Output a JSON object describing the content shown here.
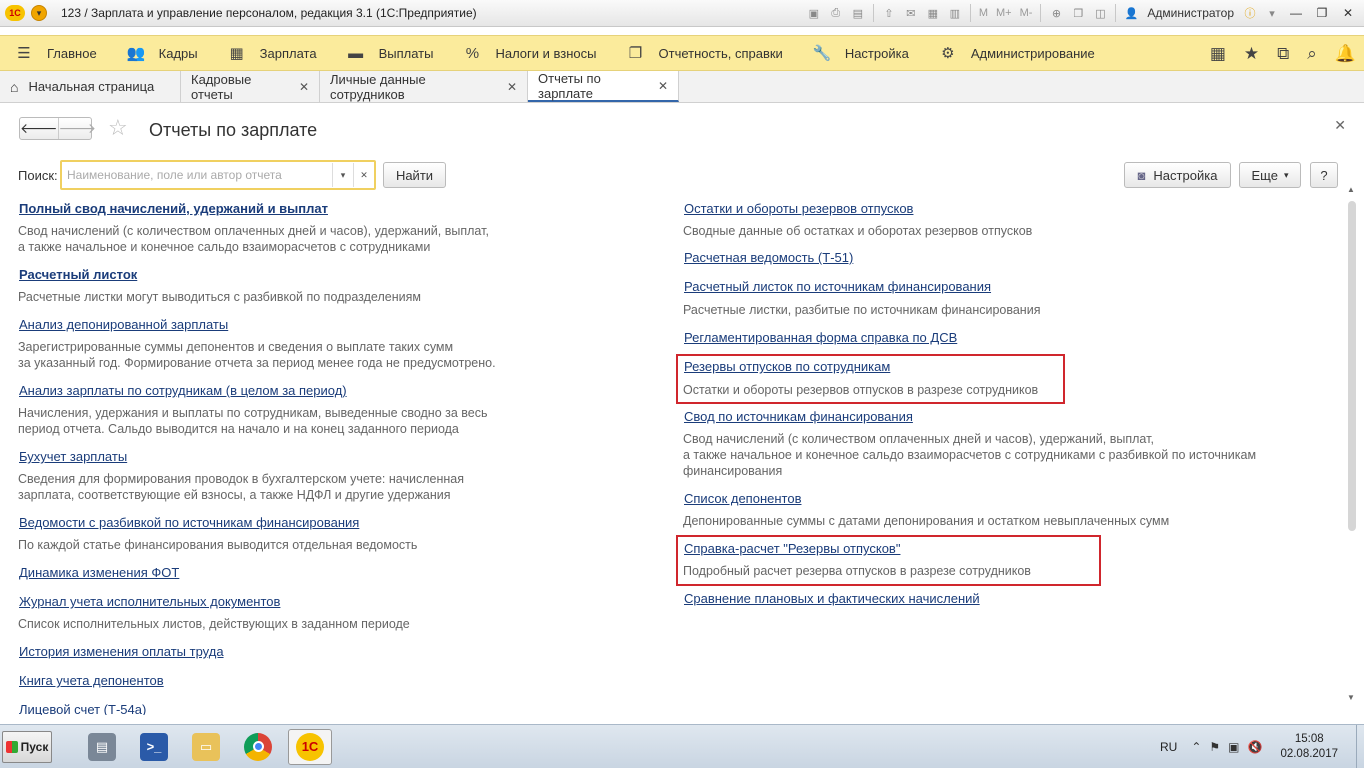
{
  "titlebar": {
    "title": "123 / Зарплата и управление персоналом, редакция 3.1  (1С:Предприятие)",
    "logo_text": "1С",
    "user": "Администратор",
    "m_buttons": [
      "M",
      "M+",
      "M-"
    ]
  },
  "menu": {
    "items": [
      {
        "icon": "hamburger-icon",
        "glyph": "☰",
        "label": "Главное"
      },
      {
        "icon": "people-icon",
        "glyph": "👥",
        "label": "Кадры"
      },
      {
        "icon": "calculator-icon",
        "glyph": "▦",
        "label": "Зарплата"
      },
      {
        "icon": "wallet-icon",
        "glyph": "▬",
        "label": "Выплаты"
      },
      {
        "icon": "percent-icon",
        "glyph": "%",
        "label": "Налоги и взносы"
      },
      {
        "icon": "documents-icon",
        "glyph": "❐",
        "label": "Отчетность, справки"
      },
      {
        "icon": "wrench-icon",
        "glyph": "🔧",
        "label": "Настройка"
      },
      {
        "icon": "gear-icon",
        "glyph": "⚙",
        "label": "Администрирование"
      }
    ]
  },
  "tabs": [
    {
      "label": "Начальная страница",
      "home": true,
      "closable": false
    },
    {
      "label": "Кадровые отчеты",
      "closable": true
    },
    {
      "label": "Личные данные сотрудников",
      "closable": true
    },
    {
      "label": "Отчеты по зарплате",
      "closable": true,
      "active": true
    }
  ],
  "form": {
    "title": "Отчеты по зарплате",
    "search_label": "Поиск:",
    "search_placeholder": "Наименование, поле или автор отчета",
    "find_button": "Найти",
    "settings_button": "Настройка",
    "more_button": "Еще",
    "help_button": "?"
  },
  "reports_left": [
    {
      "title": "Полный свод начислений, удержаний и выплат",
      "bold": true,
      "desc": [
        "Свод начислений (с количеством оплаченных дней и часов), удержаний, выплат,",
        "а также начальное и конечное сальдо взаиморасчетов с сотрудниками"
      ]
    },
    {
      "title": "Расчетный листок",
      "bold": true,
      "desc": [
        "Расчетные листки могут выводиться с разбивкой по подразделениям"
      ]
    },
    {
      "title": "Анализ депонированной зарплаты",
      "desc": [
        "Зарегистрированные суммы депонентов и сведения о выплате таких сумм",
        "за указанный год. Формирование отчета за период менее года не предусмотрено."
      ]
    },
    {
      "title": "Анализ зарплаты по сотрудникам (в целом за период)",
      "desc": [
        "Начисления, удержания и выплаты по сотрудникам, выведенные сводно за весь",
        "период отчета. Сальдо выводится на начало и на конец заданного периода"
      ]
    },
    {
      "title": "Бухучет зарплаты",
      "desc": [
        "Сведения для формирования проводок в бухгалтерском учете: начисленная",
        "зарплата, соответствующие ей взносы, а также НДФЛ и другие удержания"
      ]
    },
    {
      "title": "Ведомости с разбивкой по источникам финансирования",
      "desc": [
        "По каждой статье финансирования выводится отдельная ведомость"
      ]
    },
    {
      "title": "Динамика изменения ФОТ",
      "desc": []
    },
    {
      "title": "Журнал учета исполнительных документов",
      "desc": [
        "Список исполнительных листов, действующих в заданном периоде"
      ]
    },
    {
      "title": "История изменения оплаты труда",
      "desc": []
    },
    {
      "title": "Книга учета депонентов",
      "desc": []
    },
    {
      "title": "Лицевой счет (Т-54а)",
      "desc": []
    }
  ],
  "reports_right": [
    {
      "title": "Остатки и обороты резервов отпусков",
      "desc": [
        "Сводные данные об остатках и оборотах резервов отпусков"
      ]
    },
    {
      "title": "Расчетная ведомость (Т-51)",
      "desc": []
    },
    {
      "title": "Расчетный листок по источникам финансирования",
      "desc": [
        "Расчетные листки, разбитые по источникам финансирования"
      ]
    },
    {
      "title": "Регламентированная форма справка по ДСВ",
      "desc": []
    },
    {
      "title": "Резервы отпусков по сотрудникам",
      "highlighted": true,
      "desc": [
        "Остатки и обороты резервов отпусков в разрезе сотрудников"
      ]
    },
    {
      "title": "Свод по источникам финансирования",
      "desc": [
        "Свод начислений (с количеством оплаченных дней и часов), удержаний, выплат,",
        "а также начальное и конечное сальдо взаиморасчетов с сотрудниками с разбивкой по источникам",
        "финансирования"
      ]
    },
    {
      "title": "Список депонентов",
      "desc": [
        "Депонированные суммы с датами депонирования и остатком невыплаченных сумм"
      ]
    },
    {
      "title": "Справка-расчет \"Резервы отпусков\"",
      "highlighted": true,
      "desc": [
        "Подробный расчет резерва отпусков в разрезе сотрудников"
      ]
    },
    {
      "title": "Сравнение плановых и фактических начислений",
      "desc": []
    }
  ],
  "colors": {
    "highlight_border": "#d0262d",
    "menu_bg": "#fbeb9c",
    "link": "#1a3c7a"
  },
  "taskbar": {
    "start_label": "Пуск",
    "apps": [
      "server-manager-icon",
      "powershell-icon",
      "file-explorer-icon",
      "chrome-icon",
      "1c-icon"
    ],
    "lang": "RU",
    "time": "15:08",
    "date": "02.08.2017"
  }
}
